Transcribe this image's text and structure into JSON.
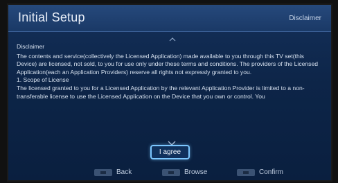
{
  "header": {
    "title": "Initial Setup",
    "crumb": "Disclaimer"
  },
  "content": {
    "heading": "Disclaimer",
    "paragraph1": "The contents and service(collectively the Licensed Application) made available to you through this TV set(this Device) are licensed, not sold, to you for use only under these terms and conditions. The providers of the Licensed Application(each an Application Providers) reserve all rights not expressly granted to you.",
    "section_title": "1. Scope of License",
    "paragraph2": "The licensed granted to you for a Licensed Application by the relevant Application Provider is limited to a non-transferable license to use the Licensed Application on the Device that you own or control. You"
  },
  "agree_button": {
    "label": "I agree"
  },
  "footer": {
    "back": "Back",
    "browse": "Browse",
    "confirm": "Confirm"
  }
}
